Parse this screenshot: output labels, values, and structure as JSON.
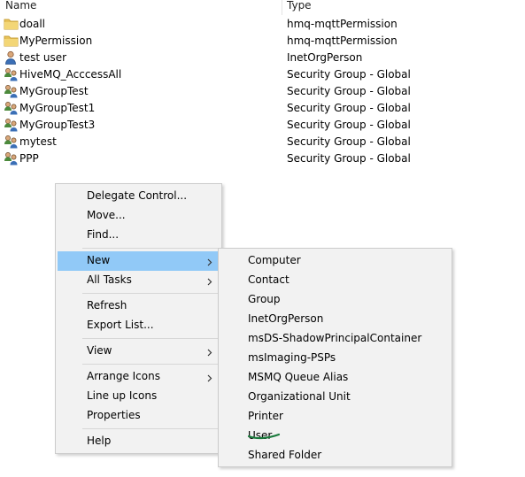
{
  "columns": {
    "name": "Name",
    "type": "Type"
  },
  "rows": [
    {
      "name": "doall",
      "type": "hmq-mqttPermission",
      "icon": "folder-icon"
    },
    {
      "name": "MyPermission",
      "type": "hmq-mqttPermission",
      "icon": "folder-icon"
    },
    {
      "name": "test user",
      "type": "InetOrgPerson",
      "icon": "user-icon"
    },
    {
      "name": "HiveMQ_AcccessAll",
      "type": "Security Group - Global",
      "icon": "group-icon"
    },
    {
      "name": "MyGroupTest",
      "type": "Security Group - Global",
      "icon": "group-icon"
    },
    {
      "name": "MyGroupTest1",
      "type": "Security Group - Global",
      "icon": "group-icon"
    },
    {
      "name": "MyGroupTest3",
      "type": "Security Group - Global",
      "icon": "group-icon"
    },
    {
      "name": "mytest",
      "type": "Security Group - Global",
      "icon": "group-icon"
    },
    {
      "name": "PPP",
      "type": "Security Group - Global",
      "icon": "group-icon"
    }
  ],
  "context_menu": {
    "items": [
      {
        "label": "Delegate Control...",
        "has_submenu": false
      },
      {
        "label": "Move...",
        "has_submenu": false
      },
      {
        "label": "Find...",
        "has_submenu": false
      },
      {
        "label": "New",
        "has_submenu": true,
        "highlighted": true
      },
      {
        "label": "All Tasks",
        "has_submenu": true
      },
      {
        "label": "Refresh",
        "has_submenu": false
      },
      {
        "label": "Export List...",
        "has_submenu": false
      },
      {
        "label": "View",
        "has_submenu": true
      },
      {
        "label": "Arrange Icons",
        "has_submenu": true
      },
      {
        "label": "Line up Icons",
        "has_submenu": false
      },
      {
        "label": "Properties",
        "has_submenu": false
      },
      {
        "label": "Help",
        "has_submenu": false
      }
    ]
  },
  "new_submenu": {
    "items": [
      {
        "label": "Computer"
      },
      {
        "label": "Contact"
      },
      {
        "label": "Group"
      },
      {
        "label": "InetOrgPerson"
      },
      {
        "label": "msDS-ShadowPrincipalContainer"
      },
      {
        "label": "msImaging-PSPs"
      },
      {
        "label": "MSMQ Queue Alias"
      },
      {
        "label": "Organizational Unit"
      },
      {
        "label": "Printer"
      },
      {
        "label": "User",
        "annotated": true
      },
      {
        "label": "Shared Folder"
      }
    ]
  },
  "colors": {
    "menu_background": "#f2f2f2",
    "highlight": "#91c9f7",
    "annotation_stroke": "#1a7a3c",
    "folder": "#e8c25a"
  }
}
